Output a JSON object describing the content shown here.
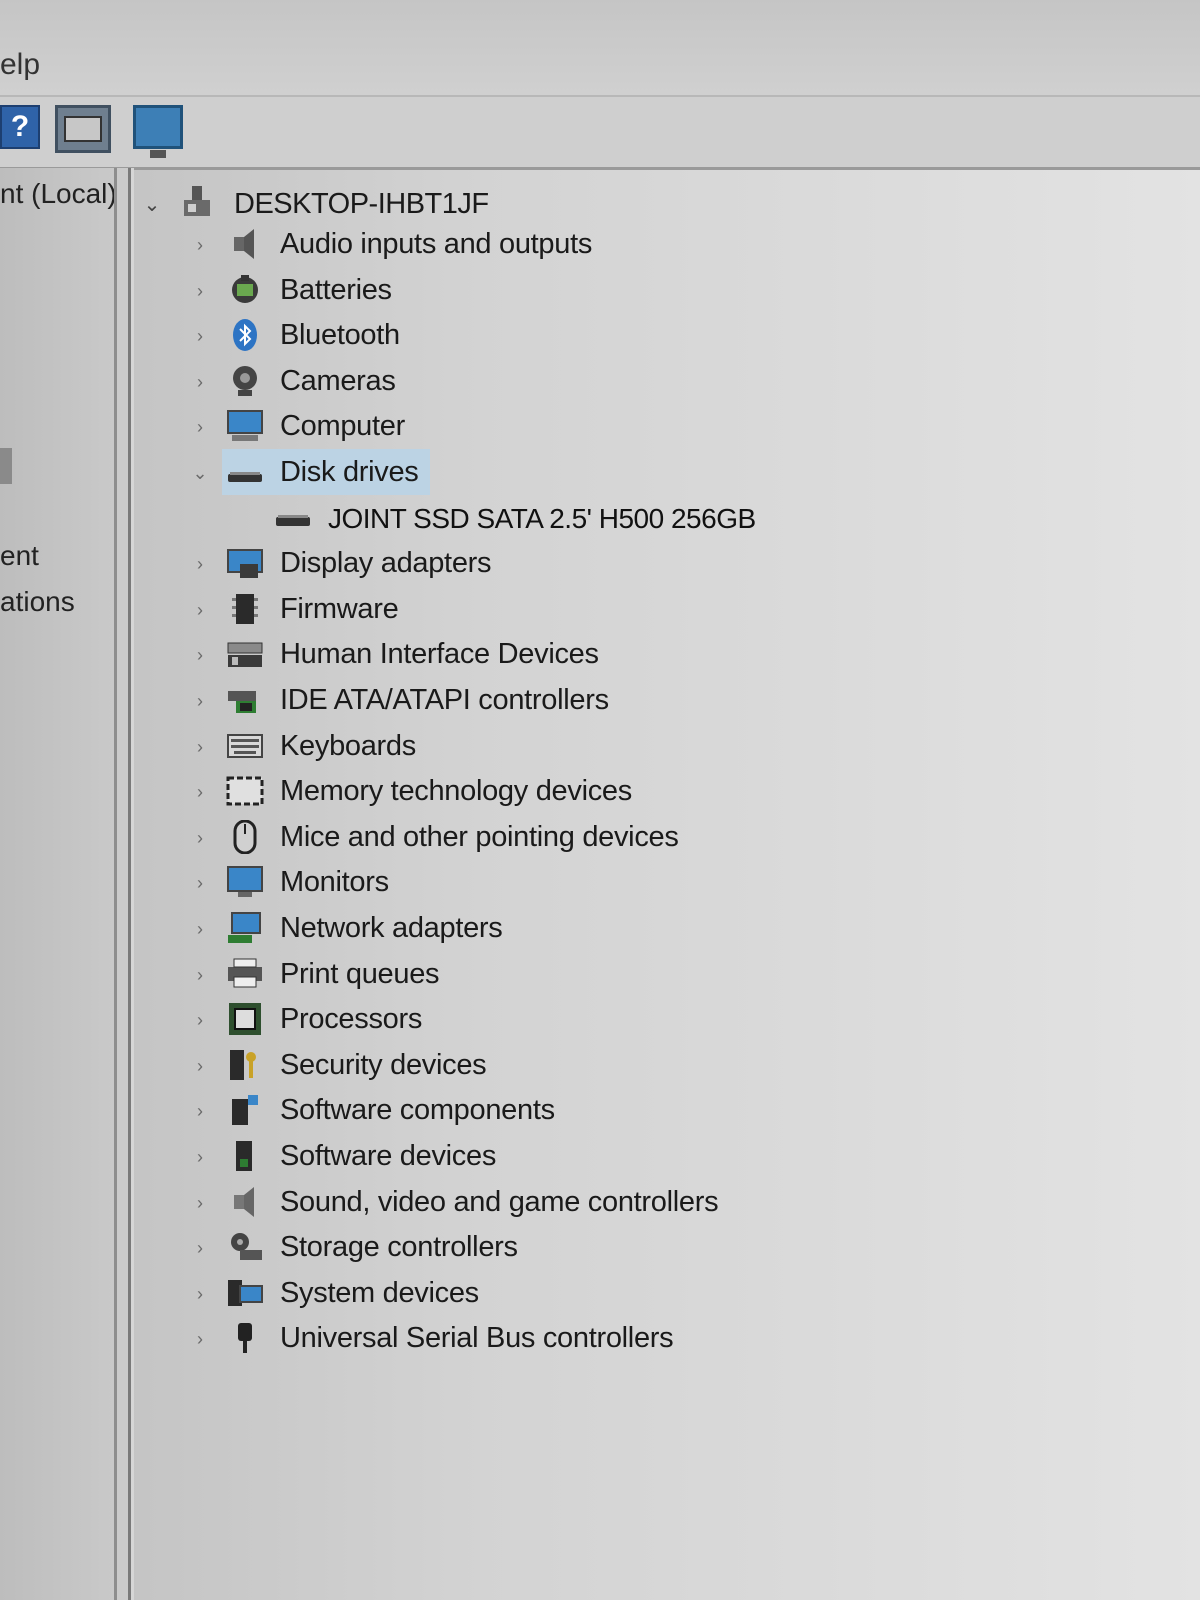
{
  "menubar": {
    "help_partial": "elp"
  },
  "toolbar": {
    "help_glyph": "?"
  },
  "left_pane": {
    "root_label": "nt (Local)",
    "item_1": "ent",
    "item_2": "ations"
  },
  "tree": {
    "root": {
      "label": "DESKTOP-IHBT1JF",
      "expanded": true
    },
    "categories": [
      {
        "label": "Audio inputs and outputs",
        "icon": "speaker-icon"
      },
      {
        "label": "Batteries",
        "icon": "battery-icon"
      },
      {
        "label": "Bluetooth",
        "icon": "bluetooth-icon"
      },
      {
        "label": "Cameras",
        "icon": "camera-icon"
      },
      {
        "label": "Computer",
        "icon": "computer-icon"
      },
      {
        "label": "Disk drives",
        "icon": "disk-drive-icon",
        "expanded": true,
        "selected": true,
        "children": [
          {
            "label": "JOINT SSD SATA 2.5' H500 256GB",
            "icon": "disk-drive-icon"
          }
        ]
      },
      {
        "label": "Display adapters",
        "icon": "display-adapter-icon"
      },
      {
        "label": "Firmware",
        "icon": "firmware-icon"
      },
      {
        "label": "Human Interface Devices",
        "icon": "hid-icon"
      },
      {
        "label": "IDE ATA/ATAPI controllers",
        "icon": "ide-controller-icon"
      },
      {
        "label": "Keyboards",
        "icon": "keyboard-icon"
      },
      {
        "label": "Memory technology devices",
        "icon": "memory-icon"
      },
      {
        "label": "Mice and other pointing devices",
        "icon": "mouse-icon"
      },
      {
        "label": "Monitors",
        "icon": "monitor-icon"
      },
      {
        "label": "Network adapters",
        "icon": "network-adapter-icon"
      },
      {
        "label": "Print queues",
        "icon": "printer-icon"
      },
      {
        "label": "Processors",
        "icon": "processor-icon"
      },
      {
        "label": "Security devices",
        "icon": "security-device-icon"
      },
      {
        "label": "Software components",
        "icon": "software-component-icon"
      },
      {
        "label": "Software devices",
        "icon": "software-device-icon"
      },
      {
        "label": "Sound, video and game controllers",
        "icon": "sound-controller-icon"
      },
      {
        "label": "Storage controllers",
        "icon": "storage-controller-icon"
      },
      {
        "label": "System devices",
        "icon": "system-device-icon"
      },
      {
        "label": "Universal Serial Bus controllers",
        "icon": "usb-icon"
      }
    ]
  },
  "colors": {
    "selection": "#bcd3e4",
    "accent_blue": "#3a7fc0"
  }
}
